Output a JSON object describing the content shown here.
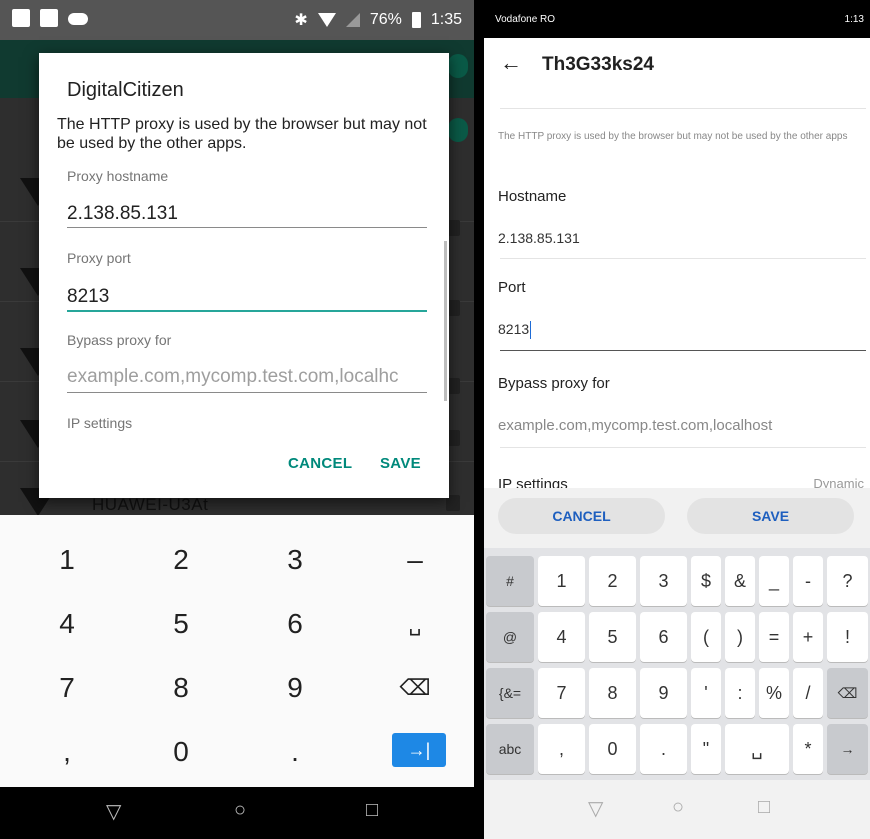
{
  "left": {
    "status": {
      "battery": "76%",
      "time": "1:35"
    },
    "background": {
      "network_name": "HUAWEI-U3At"
    },
    "dialog": {
      "title": "DigitalCitizen",
      "message": "The HTTP proxy is used by the browser but may not be used by the other apps.",
      "hostname_label": "Proxy hostname",
      "hostname_value": "2.138.85.131",
      "port_label": "Proxy port",
      "port_value": "8213",
      "bypass_label": "Bypass proxy for",
      "bypass_placeholder": "example.com,mycomp.test.com,localhc",
      "ip_label": "IP settings",
      "cancel": "CANCEL",
      "save": "SAVE"
    },
    "keypad": [
      {
        "label": "1"
      },
      {
        "label": "2"
      },
      {
        "label": "3"
      },
      {
        "label": "–"
      },
      {
        "label": "4"
      },
      {
        "label": "5"
      },
      {
        "label": "6"
      },
      {
        "label": "␣"
      },
      {
        "label": "7"
      },
      {
        "label": "8"
      },
      {
        "label": "9"
      },
      {
        "label": "⌫"
      },
      {
        "label": ","
      },
      {
        "label": "0"
      },
      {
        "label": "."
      },
      {
        "label": "→|"
      }
    ],
    "nav": {
      "back": "▽",
      "home": "○",
      "recents": "□"
    }
  },
  "right": {
    "status": {
      "carrier": "Vodafone RO",
      "time": "1:13"
    },
    "title": "Th3G33ks24",
    "note": "The HTTP proxy is used by the browser but may not be used by the other apps",
    "hostname_label": "Hostname",
    "hostname_value": "2.138.85.131",
    "port_label": "Port",
    "port_value": "8213",
    "bypass_label": "Bypass proxy for",
    "bypass_placeholder": "example.com,mycomp.test.com,localhost",
    "ip_label": "IP settings",
    "ip_value": "Dynamic",
    "cancel": "CANCEL",
    "save": "SAVE",
    "keyboard": {
      "row1": [
        "#",
        "1",
        "2",
        "3",
        "$",
        "&",
        "_",
        "-",
        "?"
      ],
      "row2": [
        "@",
        "4",
        "5",
        "6",
        "(",
        ")",
        "=",
        "+",
        "!"
      ],
      "row3": [
        "{&=",
        "7",
        "8",
        "9",
        "'",
        ":",
        "%",
        "/",
        "⌫"
      ],
      "row4": [
        "abc",
        ",",
        "0",
        ".",
        "\"",
        "␣",
        "*",
        "→"
      ]
    },
    "nav": {
      "back": "▽",
      "home": "○",
      "recents": "□"
    }
  },
  "colors": {
    "accent_left": "#00897b",
    "enter_key": "#1e88e5",
    "accent_right": "#1e5fbf"
  }
}
